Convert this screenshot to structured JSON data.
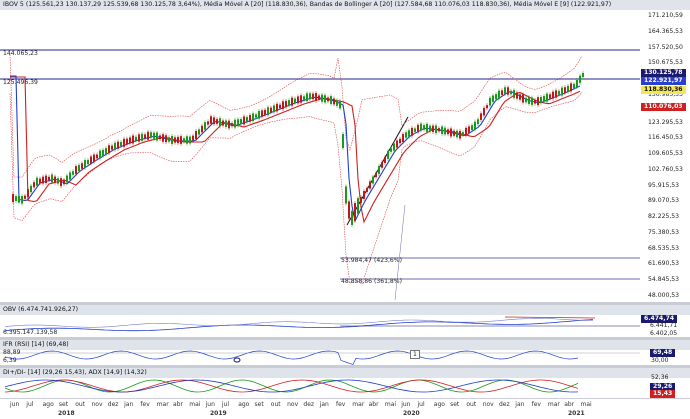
{
  "main": {
    "header": "IBOV 5 (125.561,23  130.137,29  125.539,68  130.125,78  3,64%), Média Móvel A [20] (118.830,36), Bandas de Bollinger A [20] (127.584,68  110.076,03  118.830,36), Média Móvel E [9] (122.921,97)",
    "price_axis": [
      "171.210,59",
      "164.365,53",
      "157.520,50",
      "150.675,53",
      "143.830,53",
      "136.985,53",
      "123.295,53",
      "116.450,53",
      "109.605,53",
      "102.760,53",
      "95.915,53",
      "89.070,53",
      "82.225,53",
      "75.380,53",
      "68.535,53",
      "61.690,53",
      "54.845,53",
      "48.000,53"
    ],
    "line_labels": {
      "top": "144.065,23",
      "second": "125.496,39",
      "fib1": "53.984,47 (423,6%)",
      "fib2": "48.858,86 (361,8%)"
    },
    "badges": {
      "last": "130.125,78",
      "ema": "122.921,97",
      "mm": "118.830,36",
      "low_band": "110.076,03"
    },
    "colors": {
      "ema": "#1f3fcc",
      "ma": "#d12020",
      "bands": "#e04040",
      "bull": "#1a9a1a",
      "bear": "#c01818",
      "hline": "#26268c"
    }
  },
  "obv": {
    "header": "OBV (6.474.741.926,27)",
    "left_value": "6.395.147.139,58",
    "right_values": [
      "6.474,74",
      "6.441,71",
      "6.402,05"
    ]
  },
  "ifr": {
    "header": "IFR (RSI) [14] (69,48)",
    "left_values": [
      "88,89",
      "6,39"
    ],
    "right_values": [
      "69,48",
      "30,00"
    ],
    "marker": "1"
  },
  "dmi": {
    "header": "DI+/DI- [14] (29,26  15,43), ADX [14,9] (14,32)",
    "right_values": [
      "52,36",
      "29,26",
      "15,43"
    ]
  },
  "time_axis": {
    "months": [
      "jun",
      "jul",
      "ago",
      "set",
      "out",
      "nov",
      "dez",
      "jan",
      "fev",
      "mar",
      "abr",
      "mai",
      "jun",
      "jul",
      "ago",
      "set",
      "out",
      "nov",
      "dez",
      "jan",
      "fev",
      "mar",
      "abr",
      "mai",
      "jun",
      "jul",
      "ago",
      "set",
      "out",
      "nov",
      "dez",
      "jan",
      "fev",
      "mar",
      "abr",
      "mai"
    ],
    "years": [
      "2018",
      "2019",
      "2020",
      "2021"
    ]
  }
}
